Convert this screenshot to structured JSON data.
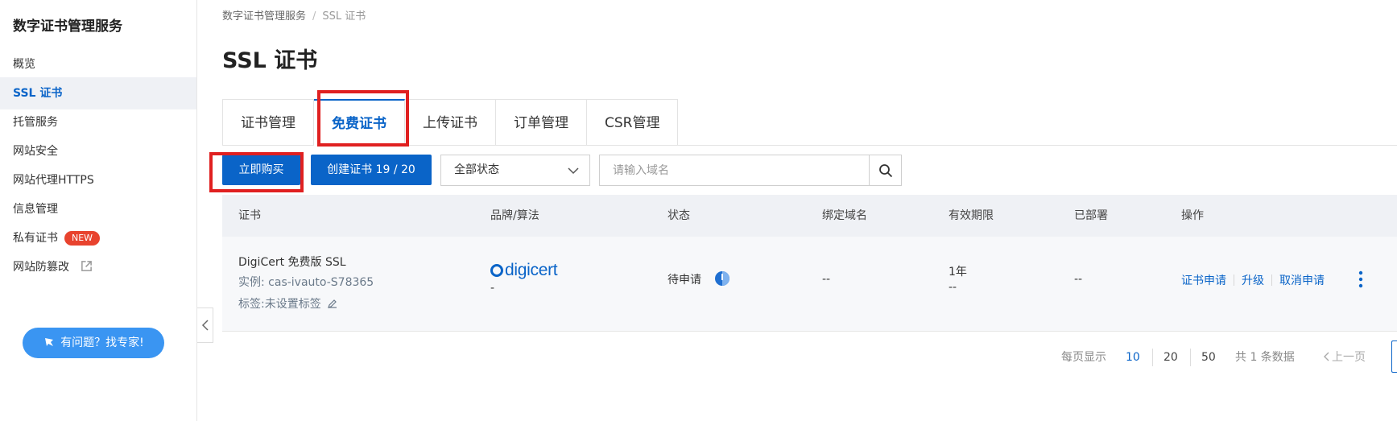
{
  "sidebar": {
    "title": "数字证书管理服务",
    "items": [
      {
        "label": "概览"
      },
      {
        "label": "SSL 证书"
      },
      {
        "label": "托管服务"
      },
      {
        "label": "网站安全"
      },
      {
        "label": "网站代理HTTPS"
      },
      {
        "label": "信息管理"
      },
      {
        "label": "私有证书",
        "badge": "NEW"
      },
      {
        "label": "网站防篡改"
      }
    ],
    "expert_button": "有问题？找专家!"
  },
  "breadcrumb": {
    "root": "数字证书管理服务",
    "separator": "/",
    "current": "SSL 证书"
  },
  "page_title": "SSL 证书",
  "tabs": [
    {
      "label": "证书管理"
    },
    {
      "label": "免费证书",
      "active": true
    },
    {
      "label": "上传证书"
    },
    {
      "label": "订单管理"
    },
    {
      "label": "CSR管理"
    }
  ],
  "toolbar": {
    "buy_button": "立即购买",
    "create_button": "创建证书 19 / 20",
    "status_select": "全部状态",
    "search_placeholder": "请输入域名"
  },
  "table": {
    "columns": [
      "证书",
      "品牌/算法",
      "状态",
      "绑定域名",
      "有效期限",
      "已部署",
      "操作"
    ],
    "rows": [
      {
        "name": "DigiCert 免费版 SSL",
        "instance": "实例: cas-ivauto-S78365",
        "tag": "标签:未设置标签",
        "brand": "digicert",
        "algorithm": "-",
        "status": "待申请",
        "domain": "--",
        "validity": "1年",
        "validity_sub": "--",
        "deployed": "--",
        "actions": [
          "证书申请",
          "升级",
          "取消申请"
        ]
      }
    ]
  },
  "pagination": {
    "per_page_label": "每页显示",
    "sizes": [
      "10",
      "20",
      "50"
    ],
    "total": "共 1 条数据",
    "prev": "上一页"
  },
  "colors": {
    "accent": "#0a64c8",
    "highlight_box": "#e02020",
    "badge": "#e8432e"
  }
}
